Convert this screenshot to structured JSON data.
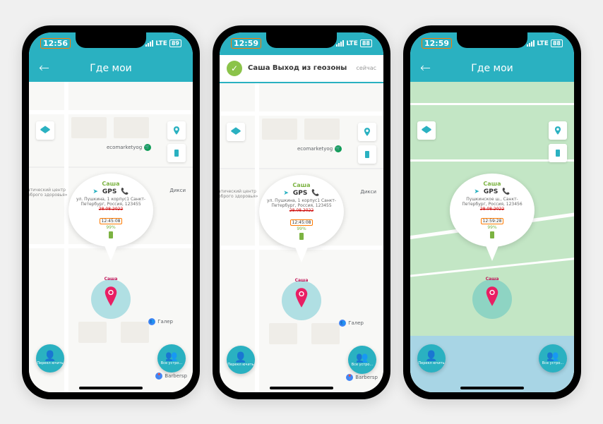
{
  "phones": [
    {
      "time": "12:56",
      "lte": "LTE",
      "battery": "89",
      "header_title": "Где мои",
      "has_notification": false,
      "map_style": "light",
      "callout": {
        "name": "Саша",
        "method": "GPS",
        "address": "ул. Пушкина, 1 корпус1 Санкт-Петербург, Россия, 123455",
        "date": "28.08.2022",
        "time": "12:45:08",
        "battery_pct": "99%"
      },
      "marker_label": "Саша",
      "poi": {
        "ecomarket": "ecomarketyog",
        "dixy": "Дикси",
        "galer": "Галер",
        "barber": "Barbersp",
        "side": "атический центр оброго здоровья»"
      },
      "fab_left": "Перекл ючить",
      "fab_right": "Все устро..."
    },
    {
      "time": "12:59",
      "lte": "LTE",
      "battery": "88",
      "header_title": "",
      "has_notification": true,
      "notification": {
        "title": "Саша  Выход из геозоны",
        "when": "сейчас"
      },
      "map_style": "light",
      "callout": {
        "name": "Саша",
        "method": "GPS",
        "address": "ул. Пушкина, 1 корпус1 Санкт-Петербург, Россия, 123455",
        "date": "28.08.2022",
        "time": "12:45:08",
        "battery_pct": "99%"
      },
      "marker_label": "Саша",
      "poi": {
        "ecomarket": "ecomarketyog",
        "dixy": "Дикси",
        "galer": "Галер",
        "barber": "Barbersp",
        "side": "атический центр оброго здоровья»"
      },
      "fab_left": "Перекл ючить",
      "fab_right": "Все устро..."
    },
    {
      "time": "12:59",
      "lte": "LTE",
      "battery": "88",
      "header_title": "Где мои",
      "has_notification": false,
      "map_style": "green",
      "callout": {
        "name": "Саша",
        "method": "GPS",
        "address": "Пушкинское ш., Санкт-Петербург, Россия, 123456",
        "date": "28.08.2022",
        "time": "12:59:28",
        "battery_pct": "99%"
      },
      "marker_label": "Саша",
      "poi": {},
      "fab_left": "Перекл ючить",
      "fab_right": "Все устро..."
    }
  ]
}
